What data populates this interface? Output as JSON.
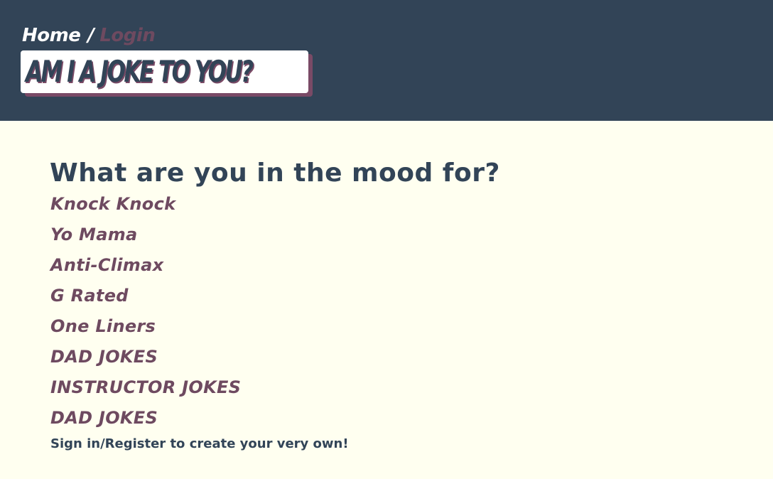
{
  "nav": {
    "home_label": "Home",
    "separator": "/",
    "login_label": "Login"
  },
  "site_title": "AM I A JOKE TO YOU?",
  "main": {
    "heading": "What are you in the mood for?",
    "categories": [
      {
        "label": "Knock Knock"
      },
      {
        "label": "Yo Mama"
      },
      {
        "label": "Anti-Climax"
      },
      {
        "label": "G Rated"
      },
      {
        "label": "One Liners"
      },
      {
        "label": "DAD JOKES"
      },
      {
        "label": "INSTRUCTOR JOKES"
      },
      {
        "label": "DAD JOKES"
      }
    ],
    "signin_text": "Sign in/Register to create your very own!"
  },
  "colors": {
    "header_bg": "#324457",
    "page_bg": "#fffff0",
    "accent": "#6e4a60",
    "text_dark": "#324457"
  }
}
